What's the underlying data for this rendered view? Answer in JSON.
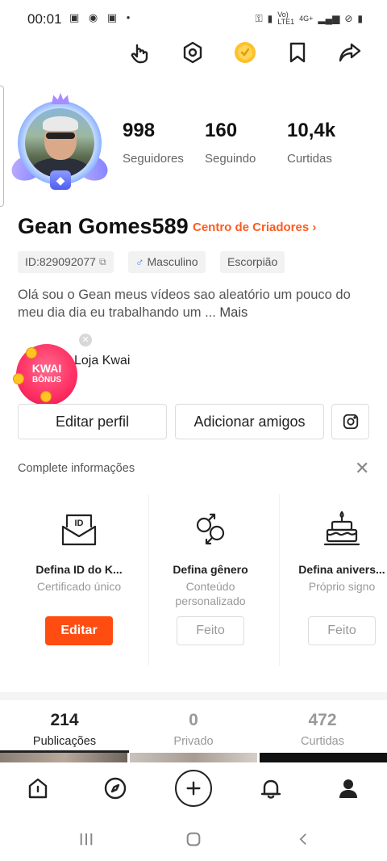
{
  "status_bar": {
    "time": "00:01",
    "network_top": "4G+",
    "network_bottom": "LTE1"
  },
  "top_actions": [
    "hand-icon",
    "settings-hexagon-icon",
    "coin-icon",
    "bookmark-icon",
    "share-icon"
  ],
  "profile": {
    "followers_count": "998",
    "followers_label": "Seguidores",
    "following_count": "160",
    "following_label": "Seguindo",
    "likes_count": "10,4k",
    "likes_label": "Curtidas",
    "name": "Gean Gomes589",
    "creator_center": "Centro de Criadores",
    "tags": {
      "id": "ID:829092077",
      "gender": "Masculino",
      "sign": "Escorpião"
    },
    "bio": "Olá sou o Gean meus vídeos sao aleatório um pouco do meu dia dia eu trabalhando um ...",
    "bio_more": "Mais"
  },
  "bonus": {
    "title": "KWAI",
    "subtitle": "BÔNUS",
    "shop_label": "Loja Kwai"
  },
  "buttons": {
    "edit_profile": "Editar perfil",
    "add_friends": "Adicionar amigos"
  },
  "complete_info": {
    "title": "Complete informações",
    "cards": [
      {
        "title": "Defina ID do K...",
        "subtitle": "Certificado único",
        "button": "Editar",
        "icon": "id-envelope-icon"
      },
      {
        "title": "Defina gênero",
        "subtitle": "Conteúdo personalizado",
        "button": "Feito",
        "icon": "gender-icon"
      },
      {
        "title": "Defina anivers...",
        "subtitle": "Próprio signo",
        "button": "Feito",
        "icon": "cake-icon"
      }
    ]
  },
  "tabs": [
    {
      "count": "214",
      "label": "Publicações"
    },
    {
      "count": "0",
      "label": "Privado"
    },
    {
      "count": "472",
      "label": "Curtidas"
    }
  ],
  "bottom_nav": [
    "home-icon",
    "discover-icon",
    "create-icon",
    "notifications-icon",
    "profile-icon"
  ],
  "colors": {
    "accent": "#ff4d12",
    "creator_link": "#ff5a1f",
    "male": "#3b8bff"
  }
}
